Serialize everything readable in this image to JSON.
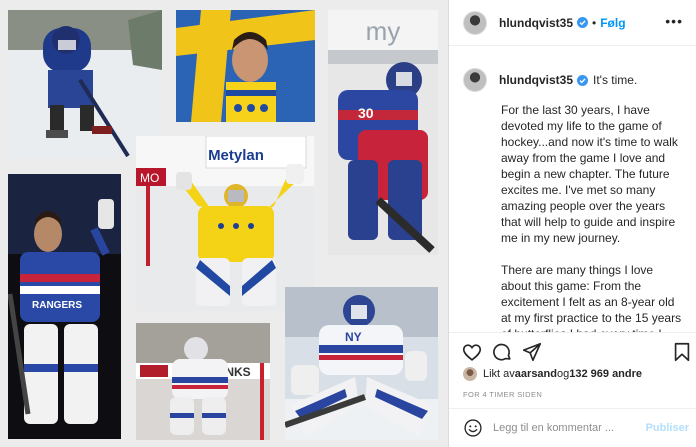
{
  "colors": {
    "accent": "#0095f6",
    "verified": "#3897f0",
    "muted": "#8e8e8e",
    "publish_disabled": "#b2dffc",
    "text": "#262626"
  },
  "collage": {
    "photos": [
      {
        "id": "skating-practice",
        "icon": "photo"
      },
      {
        "id": "sweden-flag",
        "icon": "photo"
      },
      {
        "id": "rangers-goalie-crouch",
        "icon": "photo"
      },
      {
        "id": "rangers-salute",
        "icon": "photo"
      },
      {
        "id": "sweden-celebration",
        "icon": "photo"
      },
      {
        "id": "rangers-white-save",
        "icon": "photo"
      },
      {
        "id": "rangers-white-butterfly",
        "icon": "photo"
      }
    ]
  },
  "header": {
    "username": "hlundqvist35",
    "separator": "•",
    "follow_label": "Følg",
    "more_label": "•••"
  },
  "caption": {
    "username": "hlundqvist35",
    "first_line": "It's time.",
    "paragraphs": [
      "For the last 30 years, I have devoted my life to the game of hockey...and now it's time to walk away from the game I love and begin a new chapter. The future excites me. I've met so many amazing people over the years that will help to guide and inspire me in my new journey.",
      "There are many things I love about this game: From the excitement I felt as an 8-year old at my first practice to the 15 years of butterflies I had every time I took the ice in the greatest city in the world. I'm extremely grateful for what hockey has brought me and taught me in life. These lessons will"
    ]
  },
  "actions": {
    "icons": [
      "heart-icon",
      "comment-icon",
      "share-icon",
      "bookmark-icon"
    ]
  },
  "likes": {
    "prefix": "Likt av ",
    "first_liker": "aarsand",
    "middle": " og ",
    "count_text": "132 969 andre"
  },
  "timestamp": "FOR 4 TIMER SIDEN",
  "comment": {
    "placeholder": "Legg til en kommentar ...",
    "publish_label": "Publiser"
  }
}
